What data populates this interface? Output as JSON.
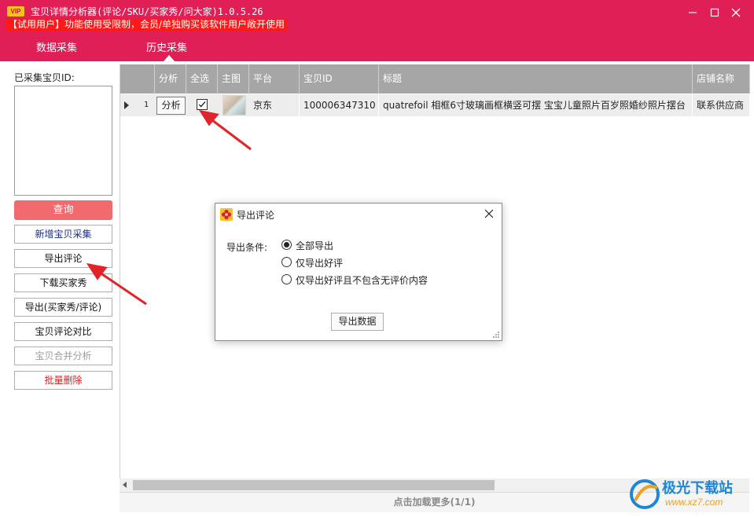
{
  "window": {
    "badge": "VIP",
    "title": "宝贝详情分析器(评论/SKU/买家秀/问大家)1.0.5.26",
    "trial_note": "【试用用户】功能使用受限制，会员/单独购买该软件用户敞开使用",
    "colors": {
      "titlebar": "#df1f55",
      "trial": "#ff1a1a",
      "accent_button": "#f26a6d"
    }
  },
  "tabs": [
    {
      "label": "数据采集",
      "active": false
    },
    {
      "label": "历史采集",
      "active": true
    }
  ],
  "sidebar": {
    "id_label": "已采集宝贝ID:",
    "query_label": "查询",
    "buttons": [
      {
        "label": "新增宝贝采集",
        "style": "blue"
      },
      {
        "label": "导出评论",
        "style": "normal"
      },
      {
        "label": "下载买家秀",
        "style": "normal"
      },
      {
        "label": "导出(买家秀/评论)",
        "style": "normal"
      },
      {
        "label": "宝贝评论对比",
        "style": "normal"
      },
      {
        "label": "宝贝合并分析",
        "style": "disabled"
      },
      {
        "label": "批量删除",
        "style": "red"
      }
    ]
  },
  "grid": {
    "columns": [
      "分析",
      "全选",
      "主图",
      "平台",
      "宝贝ID",
      "标题",
      "店铺名称"
    ],
    "rows": [
      {
        "index": "1",
        "analyze": "分析",
        "checked": true,
        "platform": "京东",
        "item_id": "100006347310",
        "title": "quatrefoil 相框6寸玻璃画框横竖可摆 宝宝儿童照片百岁照婚纱照片摆台",
        "shop": "联系供应商"
      }
    ],
    "load_more": "点击加载更多(1/1)"
  },
  "dialog": {
    "title": "导出评论",
    "condition_label": "导出条件:",
    "options": [
      {
        "label": "全部导出",
        "selected": true
      },
      {
        "label": "仅导出好评",
        "selected": false
      },
      {
        "label": "仅导出好评且不包含无评价内容",
        "selected": false
      }
    ],
    "export_button": "导出数据"
  },
  "watermark": {
    "name": "极光下载站",
    "url": "www.xz7.com"
  }
}
